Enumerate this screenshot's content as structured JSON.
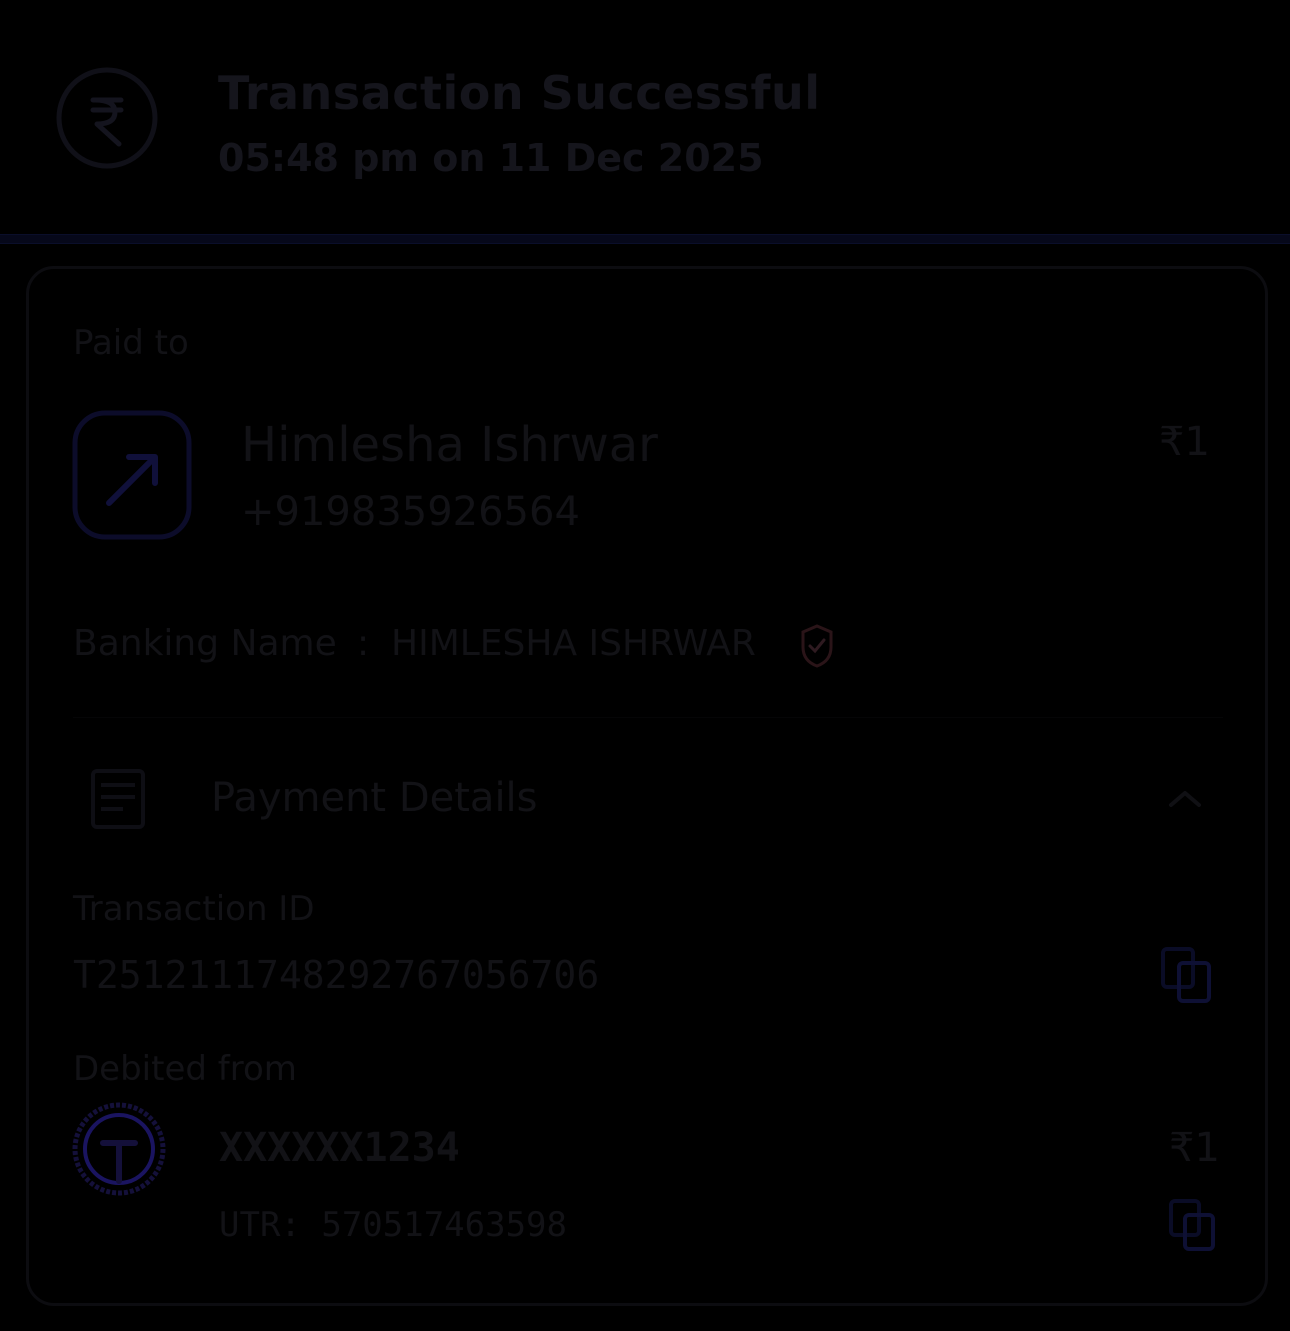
{
  "header": {
    "title": "Transaction Successful",
    "timestamp": "05:48 pm on 11 Dec 2025"
  },
  "paid_to": {
    "section_label": "Paid to",
    "name": "Himlesha Ishrwar",
    "phone": "+919835926564",
    "amount": "₹1"
  },
  "banking_name": {
    "label": "Banking Name",
    "separator": ":",
    "value": "HIMLESHA ISHRWAR"
  },
  "payment_details": {
    "label": "Payment Details"
  },
  "transaction": {
    "label": "Transaction ID",
    "value": "T2512111748292767056706"
  },
  "debited_from": {
    "label": "Debited from",
    "account": "XXXXXX1234",
    "amount": "₹1",
    "utr": "UTR: 570517463598"
  },
  "colors": {
    "background": "#000000",
    "divider": "#06081a",
    "icon_accent": "#1a1a6e",
    "verified_accent": "#3a1a20"
  }
}
